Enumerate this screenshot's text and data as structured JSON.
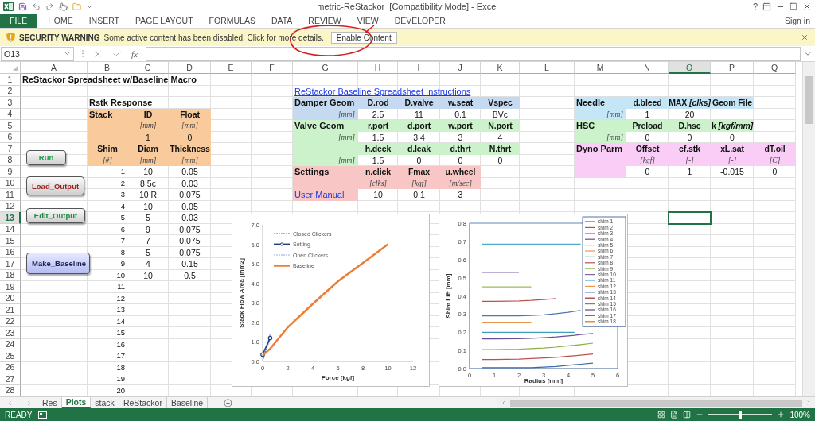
{
  "window": {
    "title": "metric-ReStackor  [Compatibility Mode] - Excel",
    "help": "?"
  },
  "ribbon_tabs": [
    {
      "label": "FILE",
      "kind": "backstage"
    },
    {
      "label": "HOME",
      "kind": "tab"
    },
    {
      "label": "INSERT",
      "kind": "tab"
    },
    {
      "label": "PAGE LAYOUT",
      "kind": "tab"
    },
    {
      "label": "FORMULAS",
      "kind": "tab"
    },
    {
      "label": "DATA",
      "kind": "tab"
    },
    {
      "label": "REVIEW",
      "kind": "tab"
    },
    {
      "label": "VIEW",
      "kind": "tab"
    },
    {
      "label": "DEVELOPER",
      "kind": "tab"
    }
  ],
  "sign_in": "Sign in",
  "security_bar": {
    "title": "SECURITY WARNING",
    "message": "Some active content has been disabled. Click for more details.",
    "button": "Enable Content"
  },
  "formula_bar": {
    "name_box": "O13",
    "function_label": "fx"
  },
  "columns": [
    {
      "label": "A",
      "selected": false
    },
    {
      "label": "B",
      "selected": false
    },
    {
      "label": "C",
      "selected": false
    },
    {
      "label": "D",
      "selected": false
    },
    {
      "label": "E",
      "selected": false
    },
    {
      "label": "F",
      "selected": false
    },
    {
      "label": "G",
      "selected": false
    },
    {
      "label": "H",
      "selected": false
    },
    {
      "label": "I",
      "selected": false
    },
    {
      "label": "J",
      "selected": false
    },
    {
      "label": "K",
      "selected": false
    },
    {
      "label": "L",
      "selected": false
    },
    {
      "label": "M",
      "selected": false
    },
    {
      "label": "N",
      "selected": false
    },
    {
      "label": "O",
      "selected": true
    },
    {
      "label": "P",
      "selected": false
    },
    {
      "label": "Q",
      "selected": false
    }
  ],
  "rows": [
    {
      "number": "1",
      "selected": false,
      "cells": [
        {
          "text": "ReStackor Spreadsheet w/Baseline Macro",
          "kind": "title"
        }
      ]
    },
    {
      "number": "2",
      "selected": false,
      "cells": [
        null,
        null,
        null,
        null,
        null,
        null,
        {
          "text": "ReStackor Baseline Spreadsheet Instructions",
          "kind": "link"
        }
      ]
    },
    {
      "number": "3",
      "selected": false,
      "cells": [
        null,
        {
          "text": "Rstk Response",
          "kind": "label"
        },
        null,
        null,
        null,
        null,
        {
          "text": "Damper Geom",
          "kind": "label",
          "color": "#c5d9f1"
        },
        {
          "text": "D.rod",
          "kind": "head",
          "color": "#c5d9f1"
        },
        {
          "text": "D.valve",
          "kind": "head",
          "color": "#c5d9f1"
        },
        {
          "text": "w.seat",
          "kind": "head",
          "color": "#c5d9f1"
        },
        {
          "text": "Vspec",
          "kind": "head",
          "color": "#c5d9f1"
        },
        null,
        {
          "text": "Needle",
          "kind": "label",
          "color": "#c5e6f7"
        },
        {
          "text": "d.bleed",
          "kind": "head",
          "color": "#c5e6f7"
        },
        {
          "text": "MAX *[clks]*",
          "kind": "head",
          "color": "#c5e6f7"
        },
        {
          "text": "Geom File",
          "kind": "head",
          "color": "#c5e6f7"
        }
      ]
    },
    {
      "number": "4",
      "selected": false,
      "cells": [
        null,
        {
          "text": "Stack",
          "kind": "label",
          "color": "#f9cb9c"
        },
        {
          "text": "ID",
          "kind": "head",
          "color": "#f9cb9c"
        },
        {
          "text": "Float",
          "kind": "head",
          "color": "#f9cb9c"
        },
        null,
        null,
        {
          "text": "[mm]",
          "kind": "side_unit",
          "color": "#c5d9f1"
        },
        {
          "text": "2.5",
          "kind": "value"
        },
        {
          "text": "11",
          "kind": "value"
        },
        {
          "text": "0.1",
          "kind": "value"
        },
        {
          "text": "BVc",
          "kind": "value"
        },
        null,
        {
          "text": "[mm]",
          "kind": "side_unit",
          "color": "#c5e6f7"
        },
        {
          "text": "1",
          "kind": "value"
        },
        {
          "text": "20",
          "kind": "value"
        }
      ]
    },
    {
      "number": "5",
      "selected": false,
      "cells": [
        null,
        {
          "color": "#f9cb9c"
        },
        {
          "text": "[mm]",
          "kind": "unit",
          "color": "#f9cb9c"
        },
        {
          "text": "[mm]",
          "kind": "unit",
          "color": "#f9cb9c"
        },
        null,
        null,
        {
          "text": "Valve Geom",
          "kind": "label",
          "color": "#ccf2cc"
        },
        {
          "text": "r.port",
          "kind": "head",
          "color": "#ccf2cc"
        },
        {
          "text": "d.port",
          "kind": "head",
          "color": "#ccf2cc"
        },
        {
          "text": "w.port",
          "kind": "head",
          "color": "#ccf2cc"
        },
        {
          "text": "N.port",
          "kind": "head",
          "color": "#ccf2cc"
        },
        null,
        {
          "text": "HSC",
          "kind": "label",
          "color": "#ccf2cc"
        },
        {
          "text": "Preload",
          "kind": "head",
          "color": "#ccf2cc"
        },
        {
          "text": "D.hsc",
          "kind": "head",
          "color": "#ccf2cc"
        },
        {
          "text": "k *[kgf/mm]*",
          "kind": "head",
          "color": "#ccf2cc"
        }
      ]
    },
    {
      "number": "6",
      "selected": false,
      "cells": [
        null,
        {
          "color": "#f9cb9c"
        },
        {
          "text": "1",
          "kind": "value",
          "color": "#f9cb9c"
        },
        {
          "text": "0",
          "kind": "value",
          "color": "#f9cb9c"
        },
        null,
        null,
        {
          "text": "[mm]",
          "kind": "side_unit",
          "color": "#ccf2cc"
        },
        {
          "text": "1.5",
          "kind": "value"
        },
        {
          "text": "3.4",
          "kind": "value"
        },
        {
          "text": "3",
          "kind": "value"
        },
        {
          "text": "4",
          "kind": "value"
        },
        null,
        {
          "text": "[mm]",
          "kind": "side_unit",
          "color": "#ccf2cc"
        },
        {
          "text": "0",
          "kind": "value"
        },
        {
          "text": "0",
          "kind": "value"
        },
        {
          "text": "0",
          "kind": "value"
        }
      ]
    },
    {
      "number": "7",
      "selected": false,
      "cells": [
        null,
        {
          "text": "Shim",
          "kind": "head",
          "color": "#f9cb9c"
        },
        {
          "text": "Diam",
          "kind": "head",
          "color": "#f9cb9c"
        },
        {
          "text": "Thickness",
          "kind": "head",
          "color": "#f9cb9c"
        },
        null,
        null,
        {
          "color": "#ccf2cc"
        },
        {
          "text": "h.deck",
          "kind": "head",
          "color": "#ccf2cc"
        },
        {
          "text": "d.leak",
          "kind": "head",
          "color": "#ccf2cc"
        },
        {
          "text": "d.thrt",
          "kind": "head",
          "color": "#ccf2cc"
        },
        {
          "text": "N.thrt",
          "kind": "head",
          "color": "#ccf2cc"
        },
        null,
        {
          "text": "Dyno Parm",
          "kind": "label",
          "color": "#f9cdf6"
        },
        {
          "text": "Offset",
          "kind": "head",
          "color": "#f9cdf6"
        },
        {
          "text": "cf.stk",
          "kind": "head",
          "color": "#f9cdf6"
        },
        {
          "text": "xL.sat",
          "kind": "head",
          "color": "#f9cdf6"
        },
        {
          "text": "dT.oil",
          "kind": "head",
          "color": "#f9cdf6"
        }
      ]
    },
    {
      "number": "8",
      "selected": false,
      "cells": [
        null,
        {
          "text": "[#]",
          "kind": "unit",
          "color": "#f9cb9c"
        },
        {
          "text": "[mm]",
          "kind": "unit",
          "color": "#f9cb9c"
        },
        {
          "text": "[mm]",
          "kind": "unit",
          "color": "#f9cb9c"
        },
        null,
        null,
        {
          "text": "[mm]",
          "kind": "side_unit",
          "color": "#ccf2cc"
        },
        {
          "text": "1.5",
          "kind": "value"
        },
        {
          "text": "0",
          "kind": "value"
        },
        {
          "text": "0",
          "kind": "value"
        },
        {
          "text": "0",
          "kind": "value"
        },
        null,
        {
          "color": "#f9cdf6"
        },
        {
          "text": "[kgf]",
          "kind": "unit",
          "color": "#f9cdf6"
        },
        {
          "text": "[-]",
          "kind": "unit",
          "color": "#f9cdf6"
        },
        {
          "text": "[-]",
          "kind": "unit",
          "color": "#f9cdf6"
        },
        {
          "text": "[C]",
          "kind": "unit",
          "color": "#f9cdf6"
        }
      ]
    },
    {
      "number": "9",
      "selected": false,
      "cells": [
        null,
        {
          "text": "1",
          "kind": "index"
        },
        {
          "text": "10",
          "kind": "value"
        },
        {
          "text": "0.05",
          "kind": "value"
        },
        null,
        null,
        {
          "text": "Settings",
          "kind": "label",
          "color": "#f7c6c5"
        },
        {
          "text": "n.click",
          "kind": "head",
          "color": "#f7c6c5"
        },
        {
          "text": "Fmax",
          "kind": "head",
          "color": "#f7c6c5"
        },
        {
          "text": "u.wheel",
          "kind": "head",
          "color": "#f7c6c5"
        },
        null,
        null,
        {
          "color": "#f9cdf6"
        },
        {
          "text": "0",
          "kind": "value"
        },
        {
          "text": "1",
          "kind": "value"
        },
        {
          "text": "-0.015",
          "kind": "value"
        },
        {
          "text": "0",
          "kind": "value"
        }
      ]
    },
    {
      "number": "10",
      "selected": false,
      "cells": [
        null,
        {
          "text": "2",
          "kind": "index"
        },
        {
          "text": "8.5c",
          "kind": "value"
        },
        {
          "text": "0.03",
          "kind": "value"
        },
        null,
        null,
        {
          "color": "#f7c6c5"
        },
        {
          "text": "[clks]",
          "kind": "unit",
          "color": "#f7c6c5"
        },
        {
          "text": "[kgf]",
          "kind": "unit",
          "color": "#f7c6c5"
        },
        {
          "text": "[m/sec]",
          "kind": "unit",
          "color": "#f7c6c5"
        }
      ]
    },
    {
      "number": "11",
      "selected": false,
      "cells": [
        null,
        {
          "text": "3",
          "kind": "index"
        },
        {
          "text": "10 R",
          "kind": "value"
        },
        {
          "text": "0.075",
          "kind": "value"
        },
        null,
        null,
        {
          "text": "User Manual",
          "kind": "link",
          "color": "#f7c6c5"
        },
        {
          "text": "10",
          "kind": "value"
        },
        {
          "text": "0.1",
          "kind": "value"
        },
        {
          "text": "3",
          "kind": "value"
        }
      ]
    },
    {
      "number": "12",
      "selected": false,
      "cells": [
        null,
        {
          "text": "4",
          "kind": "index"
        },
        {
          "text": "10",
          "kind": "value"
        },
        {
          "text": "0.05",
          "kind": "value"
        }
      ]
    },
    {
      "number": "13",
      "selected": true,
      "cells": [
        null,
        {
          "text": "5",
          "kind": "index"
        },
        {
          "text": "5",
          "kind": "value"
        },
        {
          "text": "0.03",
          "kind": "value"
        }
      ]
    },
    {
      "number": "14",
      "selected": false,
      "cells": [
        null,
        {
          "text": "6",
          "kind": "index"
        },
        {
          "text": "9",
          "kind": "value"
        },
        {
          "text": "0.075",
          "kind": "value"
        }
      ]
    },
    {
      "number": "15",
      "selected": false,
      "cells": [
        null,
        {
          "text": "7",
          "kind": "index"
        },
        {
          "text": "7",
          "kind": "value"
        },
        {
          "text": "0.075",
          "kind": "value"
        }
      ]
    },
    {
      "number": "16",
      "selected": false,
      "cells": [
        null,
        {
          "text": "8",
          "kind": "index"
        },
        {
          "text": "5",
          "kind": "value"
        },
        {
          "text": "0.075",
          "kind": "value"
        }
      ]
    },
    {
      "number": "17",
      "selected": false,
      "cells": [
        null,
        {
          "text": "9",
          "kind": "index"
        },
        {
          "text": "4",
          "kind": "value"
        },
        {
          "text": "0.15",
          "kind": "value"
        }
      ]
    },
    {
      "number": "18",
      "selected": false,
      "cells": [
        null,
        {
          "text": "10",
          "kind": "index"
        },
        {
          "text": "10",
          "kind": "value"
        },
        {
          "text": "0.5",
          "kind": "value"
        }
      ]
    },
    {
      "number": "19",
      "selected": false,
      "cells": [
        null,
        {
          "text": "11",
          "kind": "index"
        }
      ]
    },
    {
      "number": "20",
      "selected": false,
      "cells": [
        null,
        {
          "text": "12",
          "kind": "index"
        }
      ]
    },
    {
      "number": "21",
      "selected": false,
      "cells": [
        null,
        {
          "text": "13",
          "kind": "index"
        }
      ]
    },
    {
      "number": "22",
      "selected": false,
      "cells": [
        null,
        {
          "text": "14",
          "kind": "index"
        }
      ]
    },
    {
      "number": "23",
      "selected": false,
      "cells": [
        null,
        {
          "text": "15",
          "kind": "index"
        }
      ]
    },
    {
      "number": "24",
      "selected": false,
      "cells": [
        null,
        {
          "text": "16",
          "kind": "index"
        }
      ]
    },
    {
      "number": "25",
      "selected": false,
      "cells": [
        null,
        {
          "text": "17",
          "kind": "index"
        }
      ]
    },
    {
      "number": "26",
      "selected": false,
      "cells": [
        null,
        {
          "text": "18",
          "kind": "index"
        }
      ]
    },
    {
      "number": "27",
      "selected": false,
      "cells": [
        null,
        {
          "text": "19",
          "kind": "index"
        }
      ]
    },
    {
      "number": "28",
      "selected": false,
      "cells": [
        null,
        {
          "text": "20",
          "kind": "index"
        }
      ]
    }
  ],
  "macro_buttons": [
    {
      "label": "Run",
      "kind": "grey",
      "color": "#1aa04a"
    },
    {
      "label": "Load_Output",
      "kind": "grey",
      "color": "#9b1c1c"
    },
    {
      "label": "Edit_Output",
      "kind": "grey",
      "color": "#1a8a3c"
    },
    {
      "label": "Make_Baseline",
      "kind": "blue",
      "color": "#1c2452"
    }
  ],
  "charts": [
    {
      "chart_data": {
        "type": "line",
        "xlabel": "Force [kgf]",
        "ylabel": "Stack Flow Area [mm2]",
        "legend": "upper left",
        "x": [
          0,
          0.6,
          2,
          4,
          6,
          8,
          10
        ],
        "xlim": [
          0,
          12
        ],
        "ylim": [
          0,
          7
        ],
        "xticks": [
          0,
          2,
          4,
          6,
          8,
          10,
          12
        ],
        "yticks": [
          {
            "value": 0,
            "label": "0.0"
          },
          {
            "value": 1,
            "label": "1.0"
          },
          {
            "value": 2,
            "label": "2.0"
          },
          {
            "value": 3,
            "label": "3.0"
          },
          {
            "value": 4,
            "label": "4.0"
          },
          {
            "value": 5,
            "label": "5.0"
          },
          {
            "value": 6,
            "label": "6.0"
          },
          {
            "value": 7,
            "label": "7.0"
          }
        ],
        "series": [
          {
            "name": "Closed Clickers",
            "color": "#4472c4",
            "line_style": "dashed",
            "values": [
              0.0,
              1.4,
              null,
              null,
              null,
              null,
              null
            ]
          },
          {
            "name": "Setting",
            "color": "#1f3f7a",
            "line_style": "solid",
            "marker": "circle",
            "values": [
              0.35,
              1.2,
              null,
              null,
              null,
              null,
              null
            ]
          },
          {
            "name": "Open Clickers",
            "color": "#8faadc",
            "line_style": "dashed",
            "values": [
              0.3,
              1.05,
              null,
              null,
              null,
              null,
              null
            ]
          },
          {
            "name": "Baseline",
            "color": "#ed7d31",
            "line_style": "solid",
            "values": [
              0.3,
              0.65,
              1.75,
              2.95,
              4.1,
              5.05,
              6.0
            ]
          }
        ]
      }
    },
    {
      "chart_data": {
        "type": "line",
        "xlabel": "Radius [mm]",
        "ylabel": "Shim Lift [mm]",
        "legend": "upper right",
        "x": [
          0.5,
          1,
          2,
          2.5,
          3,
          3.5,
          4,
          4.25,
          4.5,
          5
        ],
        "xlim": [
          0,
          6
        ],
        "ylim": [
          0,
          0.8
        ],
        "xticks": [
          0,
          1,
          2,
          3,
          4,
          5,
          6
        ],
        "yticks": [
          {
            "value": 0,
            "label": "0.0"
          },
          {
            "value": 0.1,
            "label": "0.1"
          },
          {
            "value": 0.2,
            "label": "0.2"
          },
          {
            "value": 0.3,
            "label": "0.3"
          },
          {
            "value": 0.4,
            "label": "0.4"
          },
          {
            "value": 0.5,
            "label": "0.5"
          },
          {
            "value": 0.6,
            "label": "0.6"
          },
          {
            "value": 0.7,
            "label": "0.7"
          },
          {
            "value": 0.8,
            "label": "0.8"
          }
        ],
        "series": [
          {
            "name": "shim 1",
            "color": "#3d68a8",
            "values": [
              0.005,
              0.005,
              0.005,
              0.005,
              0.008,
              0.012,
              0.018,
              0.021,
              0.024,
              0.03
            ]
          },
          {
            "name": "shim 2",
            "color": "#c0504d",
            "values": [
              0.05,
              0.05,
              0.052,
              0.055,
              0.058,
              0.062,
              0.068,
              0.071,
              0.074,
              0.08
            ]
          },
          {
            "name": "shim 3",
            "color": "#8aad47",
            "values": [
              0.105,
              0.105,
              0.107,
              0.11,
              0.113,
              0.118,
              0.125,
              0.128,
              0.132,
              0.14
            ]
          },
          {
            "name": "shim 4",
            "color": "#6b4f96",
            "values": [
              0.163,
              0.163,
              0.165,
              0.167,
              0.17,
              0.174,
              0.18,
              0.183,
              0.187,
              0.193
            ]
          },
          {
            "name": "shim 5",
            "color": "#3fa3bd",
            "values": [
              0.2,
              0.2,
              0.2,
              0.2,
              0.2,
              0.2,
              0.2,
              0.2,
              null,
              null
            ]
          },
          {
            "name": "shim 6",
            "color": "#e9954a",
            "values": [
              0.255,
              0.255,
              0.255,
              0.255,
              null,
              null,
              null,
              null,
              null,
              null
            ]
          },
          {
            "name": "shim 7",
            "color": "#4f74b4",
            "values": [
              0.29,
              0.29,
              0.29,
              0.292,
              0.296,
              0.302,
              0.31,
              0.315,
              0.32,
              null
            ]
          },
          {
            "name": "shim 8",
            "color": "#c0504d",
            "values": [
              0.37,
              0.37,
              0.372,
              0.375,
              0.38,
              0.385,
              null,
              null,
              null,
              null
            ]
          },
          {
            "name": "shim 9",
            "color": "#9bbb59",
            "values": [
              0.45,
              0.45,
              0.45,
              0.45,
              null,
              null,
              null,
              null,
              null,
              null
            ]
          },
          {
            "name": "shim 10",
            "color": "#8064a2",
            "values": [
              0.53,
              0.53,
              0.53,
              null,
              null,
              null,
              null,
              null,
              null,
              null
            ]
          },
          {
            "name": "shim 11",
            "color": "#4bacc6",
            "values": [
              0.685,
              0.685,
              0.685,
              0.685,
              0.685,
              0.685,
              0.685,
              0.685,
              0.685,
              null
            ]
          },
          {
            "name": "shim 12",
            "color": "#f79646",
            "values": [
              null,
              null,
              null,
              null,
              null,
              null,
              null,
              null,
              null,
              null
            ]
          },
          {
            "name": "shim 13",
            "color": "#2c4d8a",
            "values": [
              null,
              null,
              null,
              null,
              null,
              null,
              null,
              null,
              null,
              null
            ]
          },
          {
            "name": "shim 14",
            "color": "#9e2f2c",
            "values": [
              null,
              null,
              null,
              null,
              null,
              null,
              null,
              null,
              null,
              null
            ]
          },
          {
            "name": "shim 15",
            "color": "#77933c",
            "values": [
              null,
              null,
              null,
              null,
              null,
              null,
              null,
              null,
              null,
              null
            ]
          },
          {
            "name": "shim 16",
            "color": "#5f497a",
            "values": [
              null,
              null,
              null,
              null,
              null,
              null,
              null,
              null,
              null,
              null
            ]
          },
          {
            "name": "shim 17",
            "color": "#31859c",
            "values": [
              null,
              null,
              null,
              null,
              null,
              null,
              null,
              null,
              null,
              null
            ]
          },
          {
            "name": "shim 18",
            "color": "#e46c0a",
            "values": [
              null,
              null,
              null,
              null,
              null,
              null,
              null,
              null,
              null,
              null
            ]
          }
        ]
      }
    }
  ],
  "sheet_tabs": [
    {
      "label": "Res",
      "selected": false
    },
    {
      "label": "Plots",
      "selected": true
    },
    {
      "label": "stack",
      "selected": false
    },
    {
      "label": "ReStackor",
      "selected": false
    },
    {
      "label": "Baseline",
      "selected": false
    }
  ],
  "status_bar": {
    "mode": "READY",
    "zoom": {
      "level": 0.5,
      "reading": "100%"
    }
  }
}
